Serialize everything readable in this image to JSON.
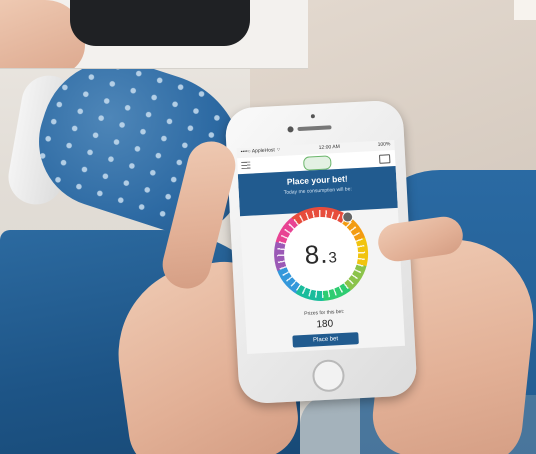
{
  "screen": {
    "status": {
      "carrier": "••••○ AppleHost ⌔",
      "time": "12:00 AM",
      "battery": "100%"
    },
    "title": "Place your bet!",
    "subtitle": "Today me consumption will be:",
    "dial_value_main": "8.",
    "dial_value_decimal": "3",
    "prize_label": "Prizes for this bet:",
    "prize_value": "180",
    "button_label": "Place bet"
  },
  "colors": {
    "accent": "#215b8f"
  }
}
